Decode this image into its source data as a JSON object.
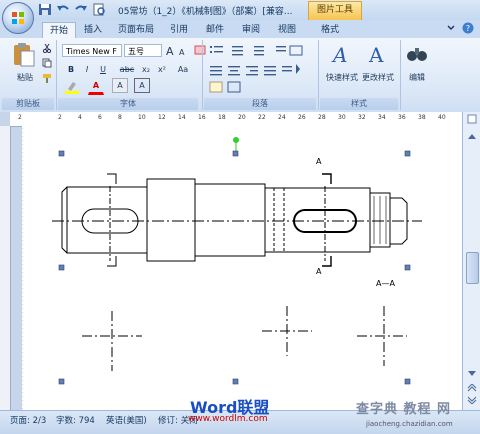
{
  "window": {
    "title": "05常坊（1_2）《机械制图》（部案）[兼容...",
    "context_tab": "图片工具"
  },
  "tabs": [
    "开始",
    "插入",
    "页面布局",
    "引用",
    "邮件",
    "审阅",
    "视图",
    "格式"
  ],
  "ribbon": {
    "clipboard": {
      "paste_label": "粘贴",
      "group_label": "剪贴板"
    },
    "font": {
      "font_name": "Times New F",
      "font_size": "五号",
      "group_label": "字体",
      "buttons": [
        "B",
        "I",
        "U",
        "abc",
        "x₂",
        "x²",
        "Aa",
        "A",
        "A",
        "A"
      ]
    },
    "paragraph": {
      "group_label": "段落"
    },
    "styles": {
      "quick_styles": "快速样式",
      "change_styles": "更改样式",
      "group_label": "样式"
    },
    "editing": {
      "label": "编辑"
    }
  },
  "ruler": {
    "ticks": [
      "2",
      "",
      "2",
      "4",
      "6",
      "8",
      "10",
      "12",
      "14",
      "16",
      "18",
      "20",
      "22",
      "24",
      "26",
      "28",
      "30",
      "32",
      "34",
      "36",
      "38",
      "40"
    ]
  },
  "drawing": {
    "label_a_top": "A",
    "label_a_bottom": "A",
    "section_label": "A—A"
  },
  "statusbar": {
    "page": "页面: 2/3",
    "words": "字数: 794",
    "language": "英语(美国)",
    "track": "修订: 关闭",
    "watermark_left": "Word联盟",
    "watermark_url": "www.wordlm.com",
    "watermark_right": "查字典 教程 网",
    "watermark_right_url": "jiaocheng.chazidian.com"
  },
  "colors": {
    "accent": "#15375f",
    "ribbon_bg": "#dfeaf8",
    "active_tab": "#f1f6fd",
    "context_tab": "#f6c453"
  }
}
